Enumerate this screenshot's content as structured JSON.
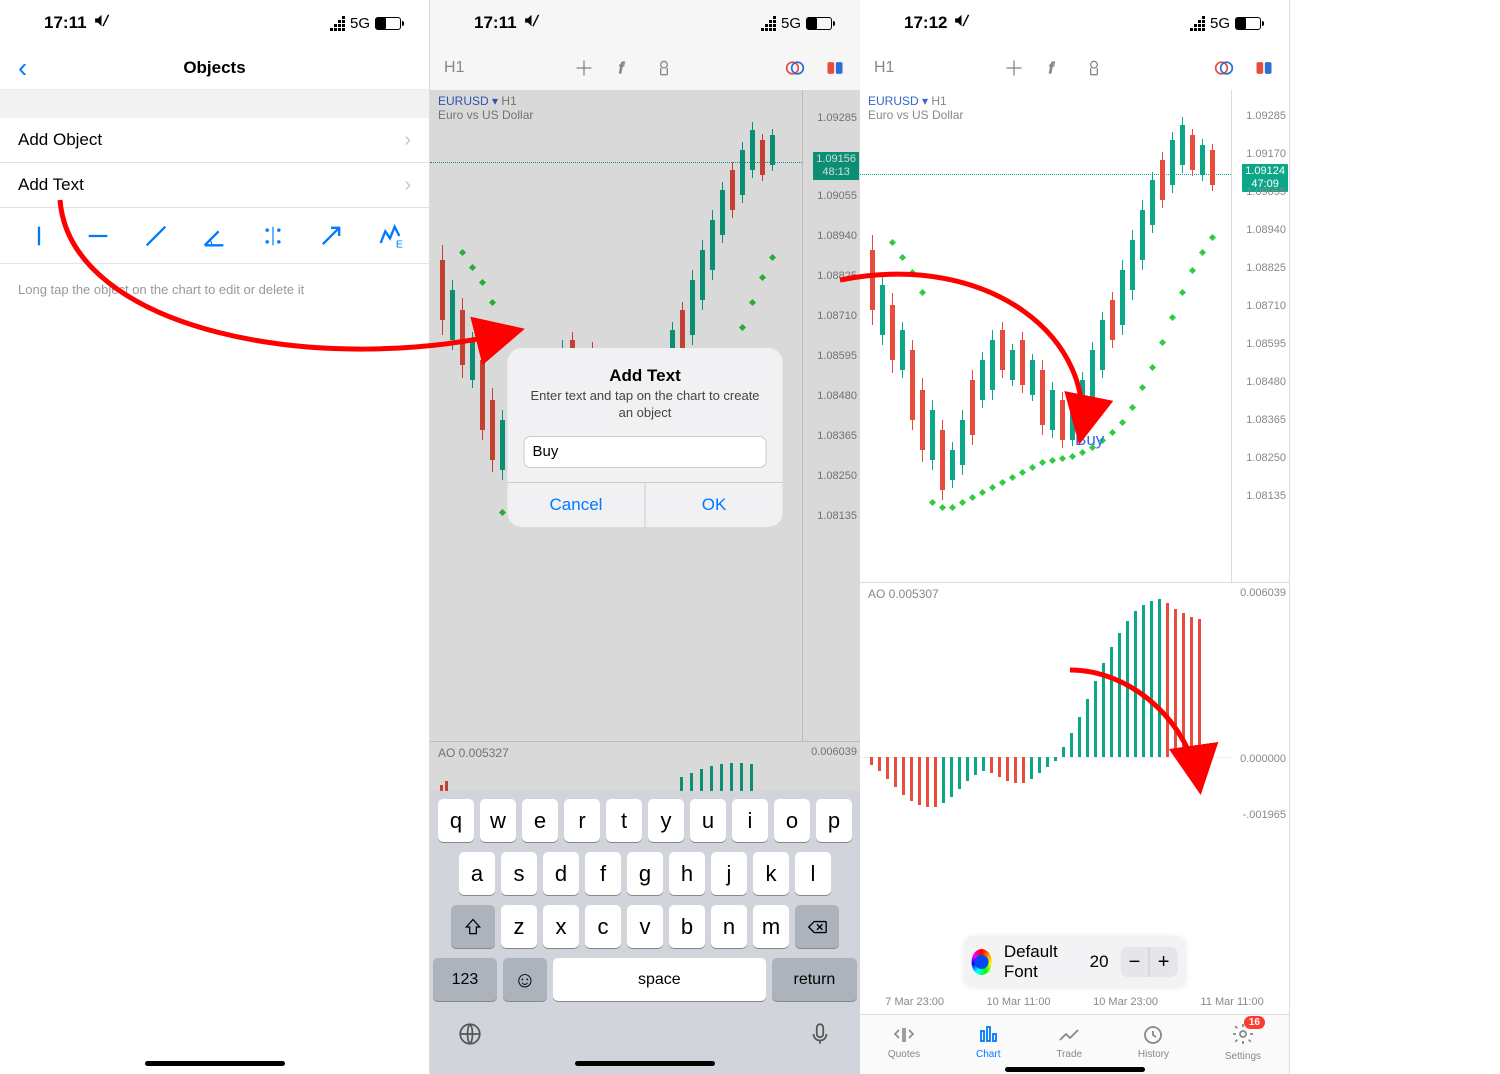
{
  "screen1": {
    "status": {
      "time": "17:11",
      "net": "5G"
    },
    "nav_title": "Objects",
    "rows": {
      "add_object": "Add Object",
      "add_text": "Add Text"
    },
    "hint": "Long tap the object on the chart to edit or delete it"
  },
  "screen2": {
    "status": {
      "time": "17:11",
      "net": "5G"
    },
    "timeframe": "H1",
    "symbol": {
      "pair": "EURUSD",
      "tf": "H1",
      "desc": "Euro vs US Dollar"
    },
    "price_ticks": [
      "1.09285",
      "1.09055",
      "1.08940",
      "1.08825",
      "1.08710",
      "1.08595",
      "1.08480",
      "1.08365",
      "1.08250",
      "1.08135"
    ],
    "price_current": "1.09156",
    "price_timer": "48:13",
    "ao_label": "AO 0.005327",
    "ao_value": "0.006039",
    "dialog": {
      "title": "Add Text",
      "message": "Enter text and tap on the chart to create an object",
      "value": "Buy",
      "cancel": "Cancel",
      "ok": "OK"
    },
    "keyboard": {
      "row1": [
        "q",
        "w",
        "e",
        "r",
        "t",
        "y",
        "u",
        "i",
        "o",
        "p"
      ],
      "row2": [
        "a",
        "s",
        "d",
        "f",
        "g",
        "h",
        "j",
        "k",
        "l"
      ],
      "row3": [
        "z",
        "x",
        "c",
        "v",
        "b",
        "n",
        "m"
      ],
      "num": "123",
      "space": "space",
      "return": "return"
    }
  },
  "screen3": {
    "status": {
      "time": "17:12",
      "net": "5G"
    },
    "timeframe": "H1",
    "symbol": {
      "pair": "EURUSD",
      "tf": "H1",
      "desc": "Euro vs US Dollar"
    },
    "price_ticks": [
      "1.09285",
      "1.09170",
      "1.09055",
      "1.08940",
      "1.08825",
      "1.08710",
      "1.08595",
      "1.08480",
      "1.08365",
      "1.08250",
      "1.08135"
    ],
    "price_current": "1.09124",
    "price_timer": "47:09",
    "ao_label": "AO 0.005307",
    "ao_ticks": [
      "0.006039",
      "0.000000",
      "-.001965"
    ],
    "buy_text": "Buy",
    "font_bar": {
      "font": "Default Font",
      "size": "20"
    },
    "time_ticks": [
      "7 Mar 23:00",
      "10 Mar 11:00",
      "10 Mar 23:00",
      "11 Mar 11:00"
    ],
    "tabs": {
      "quotes": "Quotes",
      "chart": "Chart",
      "trade": "Trade",
      "history": "History",
      "settings": "Settings",
      "badge": "16"
    }
  }
}
